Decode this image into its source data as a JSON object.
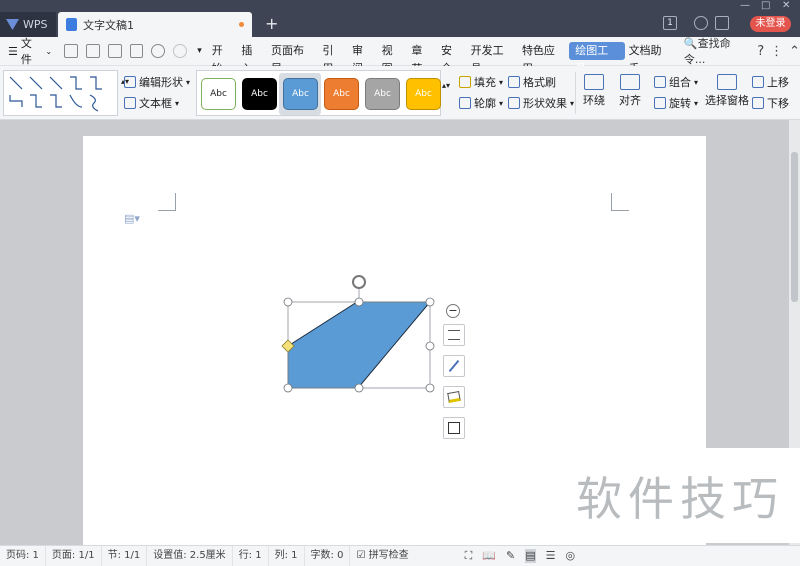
{
  "titlebar": {
    "wps_tab": "WPS",
    "doc_tab": "文字文稿1",
    "new_tab": "+",
    "login": "未登录",
    "page_count": "1"
  },
  "menubar": {
    "file": "文件",
    "items": [
      "开始",
      "插入",
      "页面布局",
      "引用",
      "审阅",
      "视图",
      "章节",
      "安全",
      "开发工具",
      "特色应用",
      "绘图工具",
      "文档助手"
    ],
    "active": "绘图工具",
    "search": "查找命令...",
    "help": "?"
  },
  "ribbon": {
    "edit_shape": "编辑形状",
    "text_box": "文本框",
    "styles": [
      {
        "label": "Abc",
        "fill": "#ffffff",
        "border": "#7fb05a",
        "text": "#222"
      },
      {
        "label": "Abc",
        "fill": "#000000",
        "border": "#000000",
        "text": "#fff"
      },
      {
        "label": "Abc",
        "fill": "#5b9bd5",
        "border": "#41719c",
        "text": "#fff"
      },
      {
        "label": "Abc",
        "fill": "#ed7d31",
        "border": "#c55a11",
        "text": "#fff"
      },
      {
        "label": "Abc",
        "fill": "#a5a5a5",
        "border": "#7b7b7b",
        "text": "#fff"
      },
      {
        "label": "Abc",
        "fill": "#ffc000",
        "border": "#bf9000",
        "text": "#fff"
      }
    ],
    "fill": "填充",
    "format_brush": "格式刷",
    "outline": "轮廓",
    "shape_effect": "形状效果",
    "wrap": "环绕",
    "align": "对齐",
    "group": "组合",
    "rotate": "旋转",
    "selection_pane": "选择窗格",
    "bring_forward": "上移",
    "send_backward": "下移"
  },
  "colors": {
    "shape_fill": "#5b9bd5",
    "shape_stroke": "#1f2d3d",
    "handle": "#ffffff",
    "adjust_handle": "#f5e17a"
  },
  "status": {
    "page_num": "页码: 1",
    "pages": "页面: 1/1",
    "section": "节: 1/1",
    "setting": "设置值: 2.5厘米",
    "row": "行: 1",
    "col": "列: 1",
    "words": "字数: 0",
    "spell": "拼写检查"
  },
  "watermark": "软件技巧"
}
